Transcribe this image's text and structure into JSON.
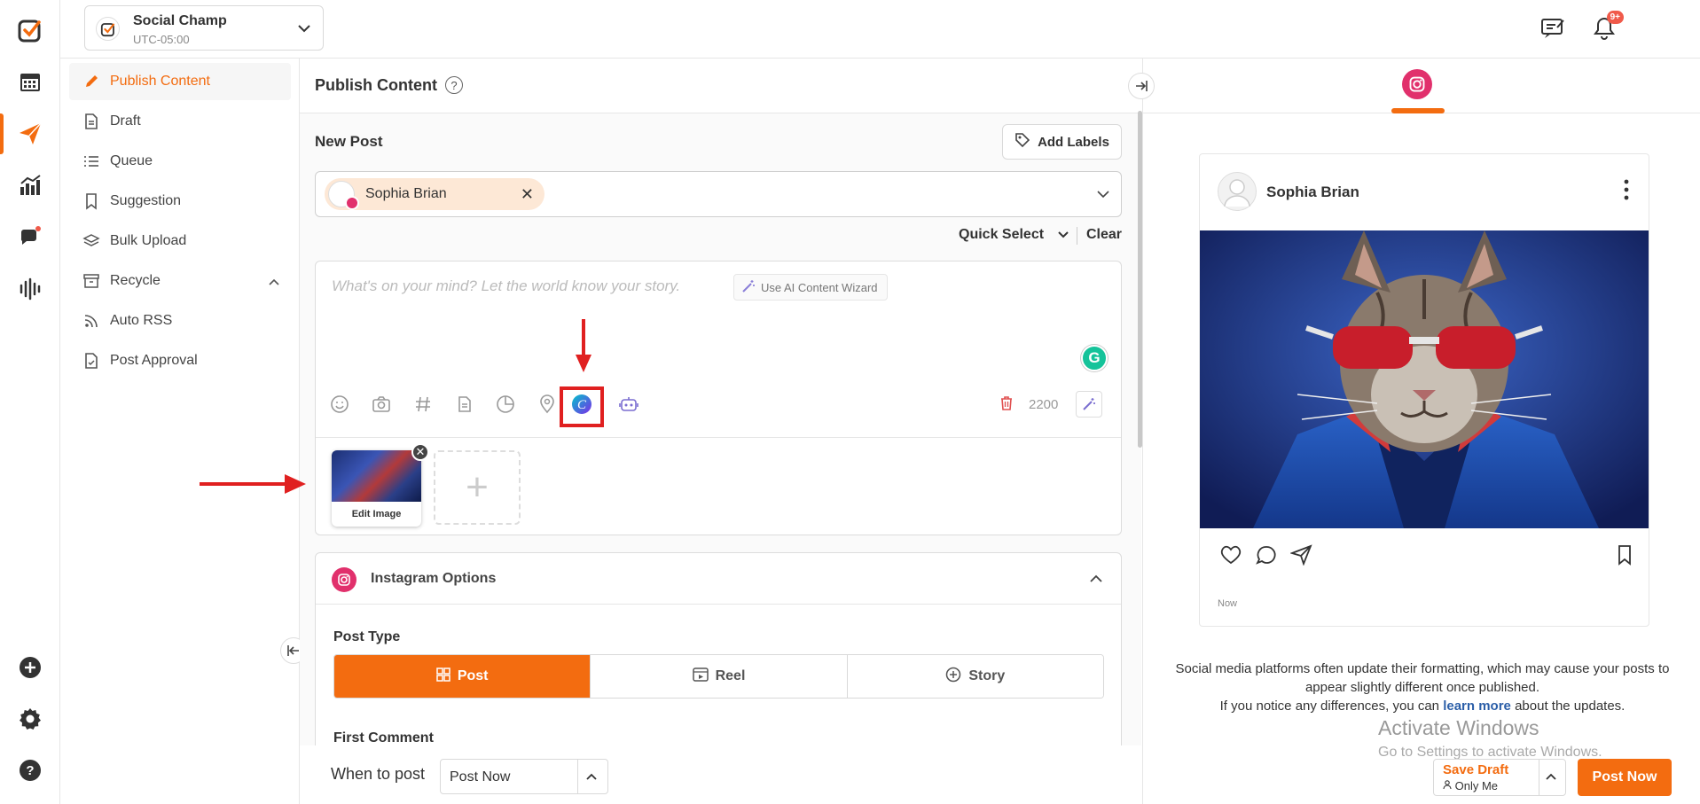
{
  "workspace": {
    "name": "Social Champ",
    "timezone": "UTC-05:00"
  },
  "topbar": {
    "notification_count": "9+"
  },
  "nav": {
    "items": [
      {
        "label": "Publish Content",
        "icon": "pencil-icon",
        "active": true
      },
      {
        "label": "Draft",
        "icon": "document-icon"
      },
      {
        "label": "Queue",
        "icon": "list-icon"
      },
      {
        "label": "Suggestion",
        "icon": "bookmark-icon"
      },
      {
        "label": "Bulk Upload",
        "icon": "layers-icon"
      },
      {
        "label": "Recycle",
        "icon": "archive-icon"
      },
      {
        "label": "Auto RSS",
        "icon": "rss-icon"
      },
      {
        "label": "Post Approval",
        "icon": "approval-icon"
      }
    ]
  },
  "center": {
    "title": "Publish Content",
    "help": "?",
    "new_post": "New Post",
    "add_labels": "Add Labels",
    "selected_account": "Sophia Brian",
    "quick_select": "Quick Select",
    "clear": "Clear",
    "editor_placeholder": "What's on your mind? Let the world know your story.",
    "ai_wizard": "Use AI Content Wizard",
    "char_count": "2200",
    "media_edit_label": "Edit Image",
    "media_add": "+",
    "instagram_options": {
      "title": "Instagram Options",
      "post_type_label": "Post Type",
      "post_types": [
        "Post",
        "Reel",
        "Story"
      ],
      "active_post_type": "Post",
      "first_comment_label": "First Comment"
    }
  },
  "schedule": {
    "label": "When to post",
    "value": "Post Now"
  },
  "preview": {
    "account_name": "Sophia Brian",
    "time": "Now",
    "note_part1": "Social media platforms often update their formatting, which may cause your posts to appear slightly different once published.",
    "note_part2": "If you notice any differences, you can",
    "note_link": "learn more",
    "note_part3": "about the updates."
  },
  "windows_watermark": {
    "line1": "Activate Windows",
    "line2": "Go to Settings to activate Windows."
  },
  "footer": {
    "save_draft": "Save Draft",
    "visibility": "Only Me",
    "post_now": "Post Now"
  },
  "colors": {
    "accent": "#f36c10",
    "instagram": "#e1306c",
    "annotation": "#e02020"
  }
}
